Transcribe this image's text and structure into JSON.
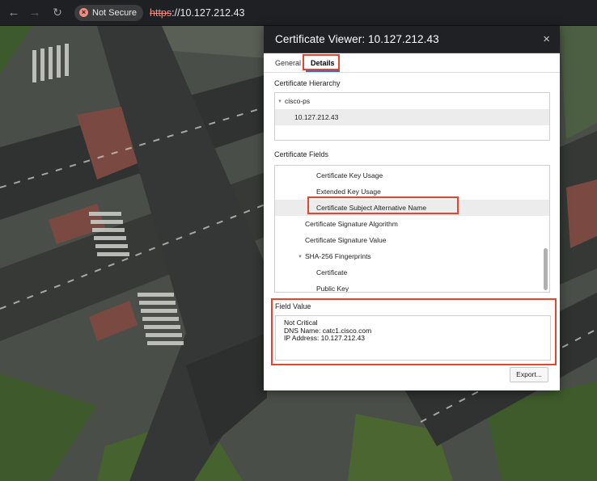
{
  "browser": {
    "security_label": "Not Secure",
    "url_scheme": "https",
    "url_rest": "://10.127.212.43"
  },
  "dialog": {
    "title": "Certificate Viewer: 10.127.212.43",
    "close_glyph": "×",
    "tabs": [
      {
        "label": "General",
        "active": false
      },
      {
        "label": "Details",
        "active": true
      }
    ],
    "hierarchy_label": "Certificate Hierarchy",
    "hierarchy": [
      {
        "label": "cisco-ps",
        "expanded": true
      },
      {
        "label": "10.127.212.43",
        "selected": true
      }
    ],
    "fields_label": "Certificate Fields",
    "fields": [
      {
        "label": "Certificate Key Usage"
      },
      {
        "label": "Extended Key Usage"
      },
      {
        "label": "Certificate Subject Alternative Name",
        "selected": true
      },
      {
        "label": "Certificate Signature Algorithm"
      },
      {
        "label": "Certificate Signature Value"
      },
      {
        "label": "SHA-256 Fingerprints",
        "expanded": true
      },
      {
        "label": "Certificate"
      },
      {
        "label": "Public Key"
      }
    ],
    "field_value_label": "Field Value",
    "field_value_lines": [
      "Not Critical",
      "DNS Name: catc1.cisco.com",
      "IP Address: 10.127.212.43"
    ],
    "export_label": "Export..."
  },
  "colors": {
    "highlight": "#e8432d",
    "toolbar": "#1f2023",
    "dialog_header": "#1f2125"
  },
  "icons": [
    "back-arrow-icon",
    "forward-arrow-icon",
    "reload-icon",
    "not-secure-icon",
    "close-icon",
    "expand-triangle-icon"
  ]
}
